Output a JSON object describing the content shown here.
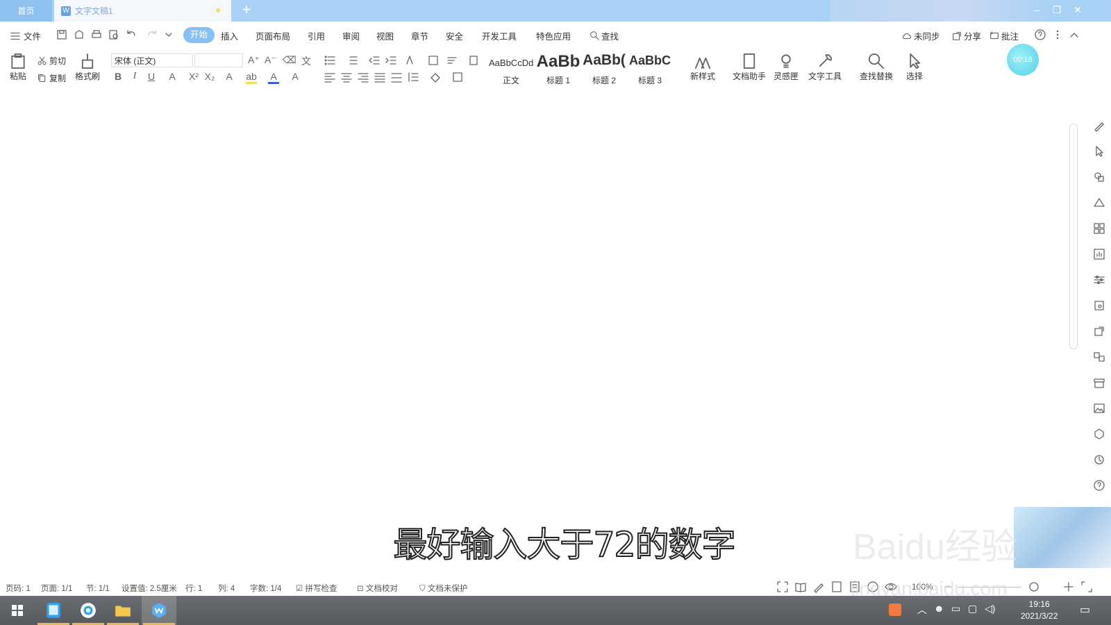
{
  "titlebar": {
    "home_tab": "首页",
    "doc_tab": "文字文稿1",
    "doc_tab_icon": "W",
    "new_tab": "+"
  },
  "menu": {
    "file": "文件",
    "tabs": [
      "开始",
      "插入",
      "页面布局",
      "引用",
      "审阅",
      "视图",
      "章节",
      "安全",
      "开发工具",
      "特色应用"
    ],
    "search": "查找",
    "sync": "未同步",
    "share": "分享",
    "comment": "批注"
  },
  "ribbon": {
    "paste": "粘贴",
    "cut": "剪切",
    "copy": "复制",
    "format_painter": "格式刷",
    "font_name": "宋体 (正文)",
    "styles": [
      {
        "sample": "AaBbCcDd",
        "label": "正文"
      },
      {
        "sample": "AaBb",
        "label": "标题 1"
      },
      {
        "sample": "AaBb(",
        "label": "标题 2"
      },
      {
        "sample": "AaBbC",
        "label": "标题 3"
      }
    ],
    "new_style": "新样式",
    "doc_assistant": "文档助手",
    "inspiration": "灵感匣",
    "text_tools": "文字工具",
    "find_replace": "查找替换",
    "select": "选择",
    "timer": "00:18"
  },
  "subtitle": "最好输入大于72的数字",
  "watermark": {
    "brand": "Baidu经验",
    "url": "jingyan.baidu.com"
  },
  "status": {
    "page_no": "页码: 1",
    "pages": "页面: 1/1",
    "section": "节: 1/1",
    "setting": "设置值: 2.5厘米",
    "row": "行: 1",
    "col": "列: 4",
    "words": "字数: 1/4",
    "spell": "拼写检查",
    "proof": "文档校对",
    "protect": "文档未保护",
    "zoom": "100%"
  },
  "taskbar": {
    "time": "19:16",
    "date": "2021/3/22"
  },
  "colors": {
    "titlebar": "#a8d1f6",
    "active_menu": "#85c1f2",
    "taskbar": "#5e6266",
    "taskbar_accent": "#f0b45a"
  }
}
